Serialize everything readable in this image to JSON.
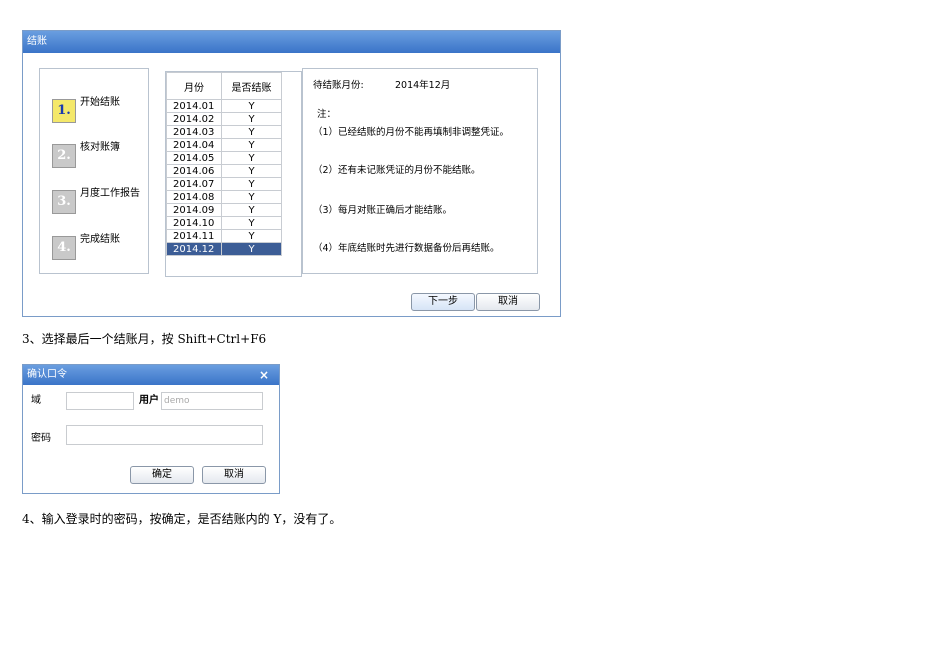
{
  "dialog1": {
    "title": "结账",
    "steps": [
      {
        "num": "1.",
        "label": "开始结账"
      },
      {
        "num": "2.",
        "label": "核对账簿"
      },
      {
        "num": "3.",
        "label": "月度工作报告"
      },
      {
        "num": "4.",
        "label": "完成结账"
      }
    ],
    "table": {
      "headers": [
        "月份",
        "是否结账"
      ],
      "rows": [
        [
          "2014.01",
          "Y"
        ],
        [
          "2014.02",
          "Y"
        ],
        [
          "2014.03",
          "Y"
        ],
        [
          "2014.04",
          "Y"
        ],
        [
          "2014.05",
          "Y"
        ],
        [
          "2014.06",
          "Y"
        ],
        [
          "2014.07",
          "Y"
        ],
        [
          "2014.08",
          "Y"
        ],
        [
          "2014.09",
          "Y"
        ],
        [
          "2014.10",
          "Y"
        ],
        [
          "2014.11",
          "Y"
        ],
        [
          "2014.12",
          "Y"
        ]
      ],
      "selected_index": 11
    },
    "pending_label": "待结账月份:",
    "pending_value": "2014年12月",
    "note_title": "注：",
    "notes": [
      "（1）已经结账的月份不能再填制非调整凭证。",
      "（2）还有未记账凭证的月份不能结账。",
      "（3）每月对账正确后才能结账。",
      "（4）年底结账时先进行数据备份后再结账。"
    ],
    "next_button": "下一步",
    "cancel_button": "取消"
  },
  "step3_text": "3、选择最后一个结账月，按 Shift+Ctrl+F6",
  "dialog2": {
    "title": "确认口令",
    "close": "×",
    "domain_label": "域",
    "domain_value": "",
    "user_label": "用户",
    "user_value": "demo",
    "password_label": "密码",
    "password_value": "",
    "ok_button": "确定",
    "cancel_button": "取消"
  },
  "step4_text": "4、输入登录时的密码，按确定，是否结账内的 Y，没有了。"
}
